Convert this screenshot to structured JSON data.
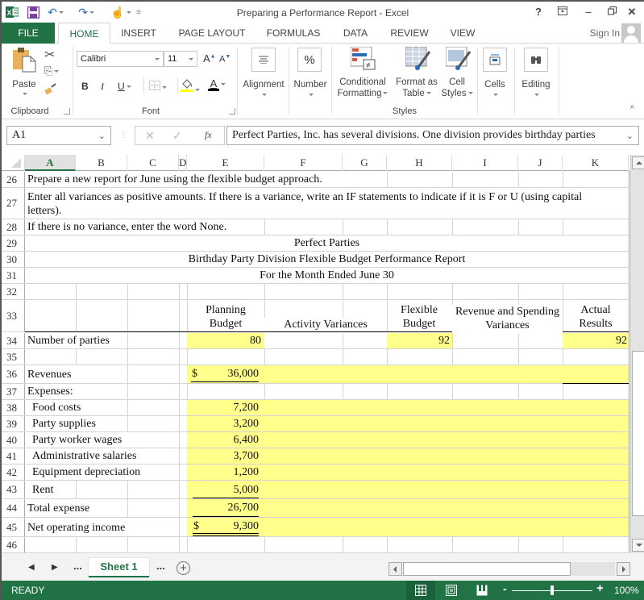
{
  "window": {
    "title": "Preparing a Performance Report - Excel",
    "help": "?",
    "ribbon_display": "ribbon-display-options-icon",
    "minimize": "minimize-icon",
    "restore": "restore-icon",
    "close": "close-icon"
  },
  "quick_access": {
    "app_icon": "excel-logo-icon",
    "save": "save-icon",
    "undo": "undo-icon",
    "redo": "redo-icon",
    "touch_mode": "touch-mode-icon",
    "customize": "customize-toolbar-icon"
  },
  "tabs": [
    {
      "label": "FILE"
    },
    {
      "label": "HOME"
    },
    {
      "label": "INSERT"
    },
    {
      "label": "PAGE LAYOUT"
    },
    {
      "label": "FORMULAS"
    },
    {
      "label": "DATA"
    },
    {
      "label": "REVIEW"
    },
    {
      "label": "VIEW"
    }
  ],
  "active_tab": "HOME",
  "account": {
    "sign_in": "Sign In"
  },
  "ribbon": {
    "clipboard": {
      "label": "Clipboard",
      "paste": "Paste"
    },
    "font": {
      "label": "Font",
      "font_name": "Calibri",
      "font_size": "11",
      "increase": "A",
      "decrease": "A",
      "bold": "B",
      "italic": "I",
      "underline": "U",
      "font_color_letter": "A",
      "highlight_color": "#ffff00",
      "font_color": "#000000"
    },
    "alignment": {
      "label": "Alignment"
    },
    "number": {
      "label": "Number",
      "icon_text": "%"
    },
    "styles": {
      "label": "Styles",
      "conditional_1": "Conditional",
      "conditional_2": "Formatting",
      "format_table_1": "Format as",
      "format_table_2": "Table",
      "cell_styles_1": "Cell",
      "cell_styles_2": "Styles"
    },
    "cells": {
      "label": "Cells"
    },
    "editing": {
      "label": "Editing"
    }
  },
  "formula_bar": {
    "name_box": "A1",
    "cancel": "✕",
    "enter": "✓",
    "fx": "fx",
    "content": "Perfect Parties, Inc. has several divisions.  One division provides birthday parties"
  },
  "columns": [
    "A",
    "B",
    "C",
    "D",
    "E",
    "F",
    "G",
    "H",
    "I",
    "J",
    "K"
  ],
  "selected_column": "A",
  "rows": {
    "r26": {
      "num": "26",
      "text": "Prepare a new report for June using the flexible budget approach."
    },
    "r27": {
      "num": "27",
      "text": "Enter all variances as positive amounts.  If there is a variance, write an IF statements to indicate if it is F or U (using capital letters)."
    },
    "r28": {
      "num": "28",
      "text": "If there is no variance, enter the word None."
    },
    "r29": {
      "num": "29",
      "text": "Perfect Parties"
    },
    "r30": {
      "num": "30",
      "text": "Birthday Party Division Flexible Budget Performance Report"
    },
    "r31": {
      "num": "31",
      "text": "For the Month Ended June 30"
    },
    "r32": {
      "num": "32"
    },
    "r33": {
      "num": "33",
      "planning_budget": "Planning Budget",
      "activity_variances": "Activity Variances",
      "flexible_budget": "Flexible Budget",
      "revenue_spending_variances": "Revenue and Spending Variances",
      "actual_results": "Actual Results"
    },
    "r34": {
      "num": "34",
      "label": "Number of parties",
      "planning": "80",
      "flexible": "92",
      "actual": "92"
    },
    "r35": {
      "num": "35"
    },
    "r36": {
      "num": "36",
      "label": "Revenues",
      "currency": "$",
      "planning": "36,000"
    },
    "r37": {
      "num": "37",
      "label": "Expenses:"
    },
    "r38": {
      "num": "38",
      "label": "Food costs",
      "planning": "7,200"
    },
    "r39": {
      "num": "39",
      "label": "Party supplies",
      "planning": "3,200"
    },
    "r40": {
      "num": "40",
      "label": "Party worker wages",
      "planning": "6,400"
    },
    "r41": {
      "num": "41",
      "label": "Administrative salaries",
      "planning": "3,700"
    },
    "r42": {
      "num": "42",
      "label": "Equipment depreciation",
      "planning": "1,200"
    },
    "r43": {
      "num": "43",
      "label": "Rent",
      "planning": "5,000"
    },
    "r44": {
      "num": "44",
      "label": "Total expense",
      "planning": "26,700"
    },
    "r45": {
      "num": "45",
      "label": "Net operating income",
      "currency": "$",
      "planning": "9,300"
    },
    "r46": {
      "num": "46"
    }
  },
  "sheet_tabs": {
    "prev": "◀",
    "next": "▶",
    "ellipsis_left": "...",
    "active": "Sheet 1",
    "ellipsis_right": "...",
    "add": "+"
  },
  "status_bar": {
    "mode": "READY",
    "zoom_level": "100%",
    "zoom_minus": "-",
    "zoom_plus": "+"
  },
  "colors": {
    "brand_green": "#217346",
    "input_yellow": "#ffff8c"
  }
}
